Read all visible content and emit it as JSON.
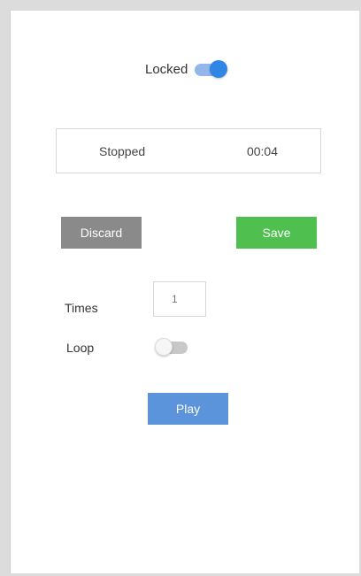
{
  "lock": {
    "label": "Locked",
    "on": true
  },
  "status": {
    "state": "Stopped",
    "time": "00:04"
  },
  "buttons": {
    "discard": "Discard",
    "save": "Save",
    "play": "Play"
  },
  "times": {
    "label": "Times",
    "value": "1"
  },
  "loop": {
    "label": "Loop",
    "on": false
  },
  "colors": {
    "toggle_on": "#2f86e6",
    "discard": "#8a8a8a",
    "save": "#4fbf4f",
    "play": "#5b94da"
  }
}
